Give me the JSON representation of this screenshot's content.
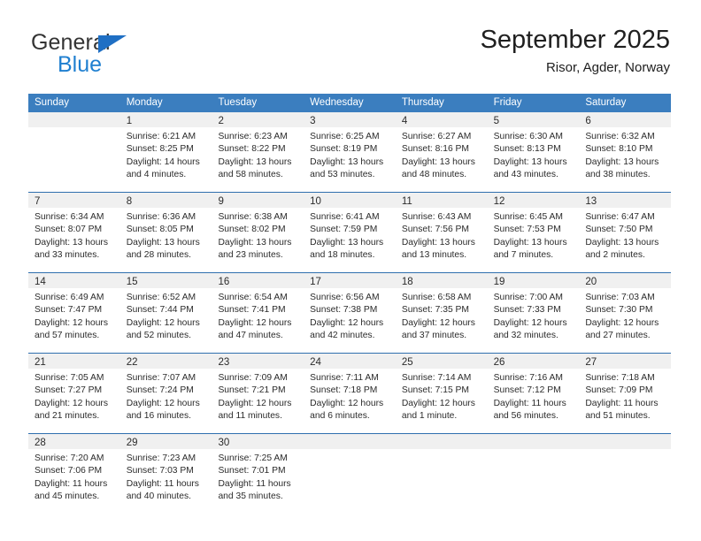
{
  "logo": {
    "primary_text": "General",
    "secondary_text": "Blue",
    "triangle_icon": "triangle-icon",
    "primary_color": "#333333",
    "secondary_color": "#1f7fd0",
    "accent_color": "#1f6fc4"
  },
  "header": {
    "title": "September 2025",
    "subtitle": "Risor, Agder, Norway"
  },
  "theme": {
    "header_row_bg": "#3b7ebf",
    "header_row_text": "#ffffff",
    "daynum_band_bg": "#f0f0f0",
    "row_divider": "#2f6fae",
    "text": "#2b2b2b"
  },
  "calendar": {
    "weekdays": [
      "Sunday",
      "Monday",
      "Tuesday",
      "Wednesday",
      "Thursday",
      "Friday",
      "Saturday"
    ],
    "weeks": [
      [
        {
          "day": "",
          "sunrise": "",
          "sunset": "",
          "daylight": "",
          "empty": true
        },
        {
          "day": "1",
          "sunrise": "Sunrise: 6:21 AM",
          "sunset": "Sunset: 8:25 PM",
          "daylight": "Daylight: 14 hours and 4 minutes."
        },
        {
          "day": "2",
          "sunrise": "Sunrise: 6:23 AM",
          "sunset": "Sunset: 8:22 PM",
          "daylight": "Daylight: 13 hours and 58 minutes."
        },
        {
          "day": "3",
          "sunrise": "Sunrise: 6:25 AM",
          "sunset": "Sunset: 8:19 PM",
          "daylight": "Daylight: 13 hours and 53 minutes."
        },
        {
          "day": "4",
          "sunrise": "Sunrise: 6:27 AM",
          "sunset": "Sunset: 8:16 PM",
          "daylight": "Daylight: 13 hours and 48 minutes."
        },
        {
          "day": "5",
          "sunrise": "Sunrise: 6:30 AM",
          "sunset": "Sunset: 8:13 PM",
          "daylight": "Daylight: 13 hours and 43 minutes."
        },
        {
          "day": "6",
          "sunrise": "Sunrise: 6:32 AM",
          "sunset": "Sunset: 8:10 PM",
          "daylight": "Daylight: 13 hours and 38 minutes."
        }
      ],
      [
        {
          "day": "7",
          "sunrise": "Sunrise: 6:34 AM",
          "sunset": "Sunset: 8:07 PM",
          "daylight": "Daylight: 13 hours and 33 minutes."
        },
        {
          "day": "8",
          "sunrise": "Sunrise: 6:36 AM",
          "sunset": "Sunset: 8:05 PM",
          "daylight": "Daylight: 13 hours and 28 minutes."
        },
        {
          "day": "9",
          "sunrise": "Sunrise: 6:38 AM",
          "sunset": "Sunset: 8:02 PM",
          "daylight": "Daylight: 13 hours and 23 minutes."
        },
        {
          "day": "10",
          "sunrise": "Sunrise: 6:41 AM",
          "sunset": "Sunset: 7:59 PM",
          "daylight": "Daylight: 13 hours and 18 minutes."
        },
        {
          "day": "11",
          "sunrise": "Sunrise: 6:43 AM",
          "sunset": "Sunset: 7:56 PM",
          "daylight": "Daylight: 13 hours and 13 minutes."
        },
        {
          "day": "12",
          "sunrise": "Sunrise: 6:45 AM",
          "sunset": "Sunset: 7:53 PM",
          "daylight": "Daylight: 13 hours and 7 minutes."
        },
        {
          "day": "13",
          "sunrise": "Sunrise: 6:47 AM",
          "sunset": "Sunset: 7:50 PM",
          "daylight": "Daylight: 13 hours and 2 minutes."
        }
      ],
      [
        {
          "day": "14",
          "sunrise": "Sunrise: 6:49 AM",
          "sunset": "Sunset: 7:47 PM",
          "daylight": "Daylight: 12 hours and 57 minutes."
        },
        {
          "day": "15",
          "sunrise": "Sunrise: 6:52 AM",
          "sunset": "Sunset: 7:44 PM",
          "daylight": "Daylight: 12 hours and 52 minutes."
        },
        {
          "day": "16",
          "sunrise": "Sunrise: 6:54 AM",
          "sunset": "Sunset: 7:41 PM",
          "daylight": "Daylight: 12 hours and 47 minutes."
        },
        {
          "day": "17",
          "sunrise": "Sunrise: 6:56 AM",
          "sunset": "Sunset: 7:38 PM",
          "daylight": "Daylight: 12 hours and 42 minutes."
        },
        {
          "day": "18",
          "sunrise": "Sunrise: 6:58 AM",
          "sunset": "Sunset: 7:35 PM",
          "daylight": "Daylight: 12 hours and 37 minutes."
        },
        {
          "day": "19",
          "sunrise": "Sunrise: 7:00 AM",
          "sunset": "Sunset: 7:33 PM",
          "daylight": "Daylight: 12 hours and 32 minutes."
        },
        {
          "day": "20",
          "sunrise": "Sunrise: 7:03 AM",
          "sunset": "Sunset: 7:30 PM",
          "daylight": "Daylight: 12 hours and 27 minutes."
        }
      ],
      [
        {
          "day": "21",
          "sunrise": "Sunrise: 7:05 AM",
          "sunset": "Sunset: 7:27 PM",
          "daylight": "Daylight: 12 hours and 21 minutes."
        },
        {
          "day": "22",
          "sunrise": "Sunrise: 7:07 AM",
          "sunset": "Sunset: 7:24 PM",
          "daylight": "Daylight: 12 hours and 16 minutes."
        },
        {
          "day": "23",
          "sunrise": "Sunrise: 7:09 AM",
          "sunset": "Sunset: 7:21 PM",
          "daylight": "Daylight: 12 hours and 11 minutes."
        },
        {
          "day": "24",
          "sunrise": "Sunrise: 7:11 AM",
          "sunset": "Sunset: 7:18 PM",
          "daylight": "Daylight: 12 hours and 6 minutes."
        },
        {
          "day": "25",
          "sunrise": "Sunrise: 7:14 AM",
          "sunset": "Sunset: 7:15 PM",
          "daylight": "Daylight: 12 hours and 1 minute."
        },
        {
          "day": "26",
          "sunrise": "Sunrise: 7:16 AM",
          "sunset": "Sunset: 7:12 PM",
          "daylight": "Daylight: 11 hours and 56 minutes."
        },
        {
          "day": "27",
          "sunrise": "Sunrise: 7:18 AM",
          "sunset": "Sunset: 7:09 PM",
          "daylight": "Daylight: 11 hours and 51 minutes."
        }
      ],
      [
        {
          "day": "28",
          "sunrise": "Sunrise: 7:20 AM",
          "sunset": "Sunset: 7:06 PM",
          "daylight": "Daylight: 11 hours and 45 minutes."
        },
        {
          "day": "29",
          "sunrise": "Sunrise: 7:23 AM",
          "sunset": "Sunset: 7:03 PM",
          "daylight": "Daylight: 11 hours and 40 minutes."
        },
        {
          "day": "30",
          "sunrise": "Sunrise: 7:25 AM",
          "sunset": "Sunset: 7:01 PM",
          "daylight": "Daylight: 11 hours and 35 minutes."
        },
        {
          "day": "",
          "sunrise": "",
          "sunset": "",
          "daylight": "",
          "empty": true
        },
        {
          "day": "",
          "sunrise": "",
          "sunset": "",
          "daylight": "",
          "empty": true
        },
        {
          "day": "",
          "sunrise": "",
          "sunset": "",
          "daylight": "",
          "empty": true
        },
        {
          "day": "",
          "sunrise": "",
          "sunset": "",
          "daylight": "",
          "empty": true
        }
      ]
    ]
  }
}
